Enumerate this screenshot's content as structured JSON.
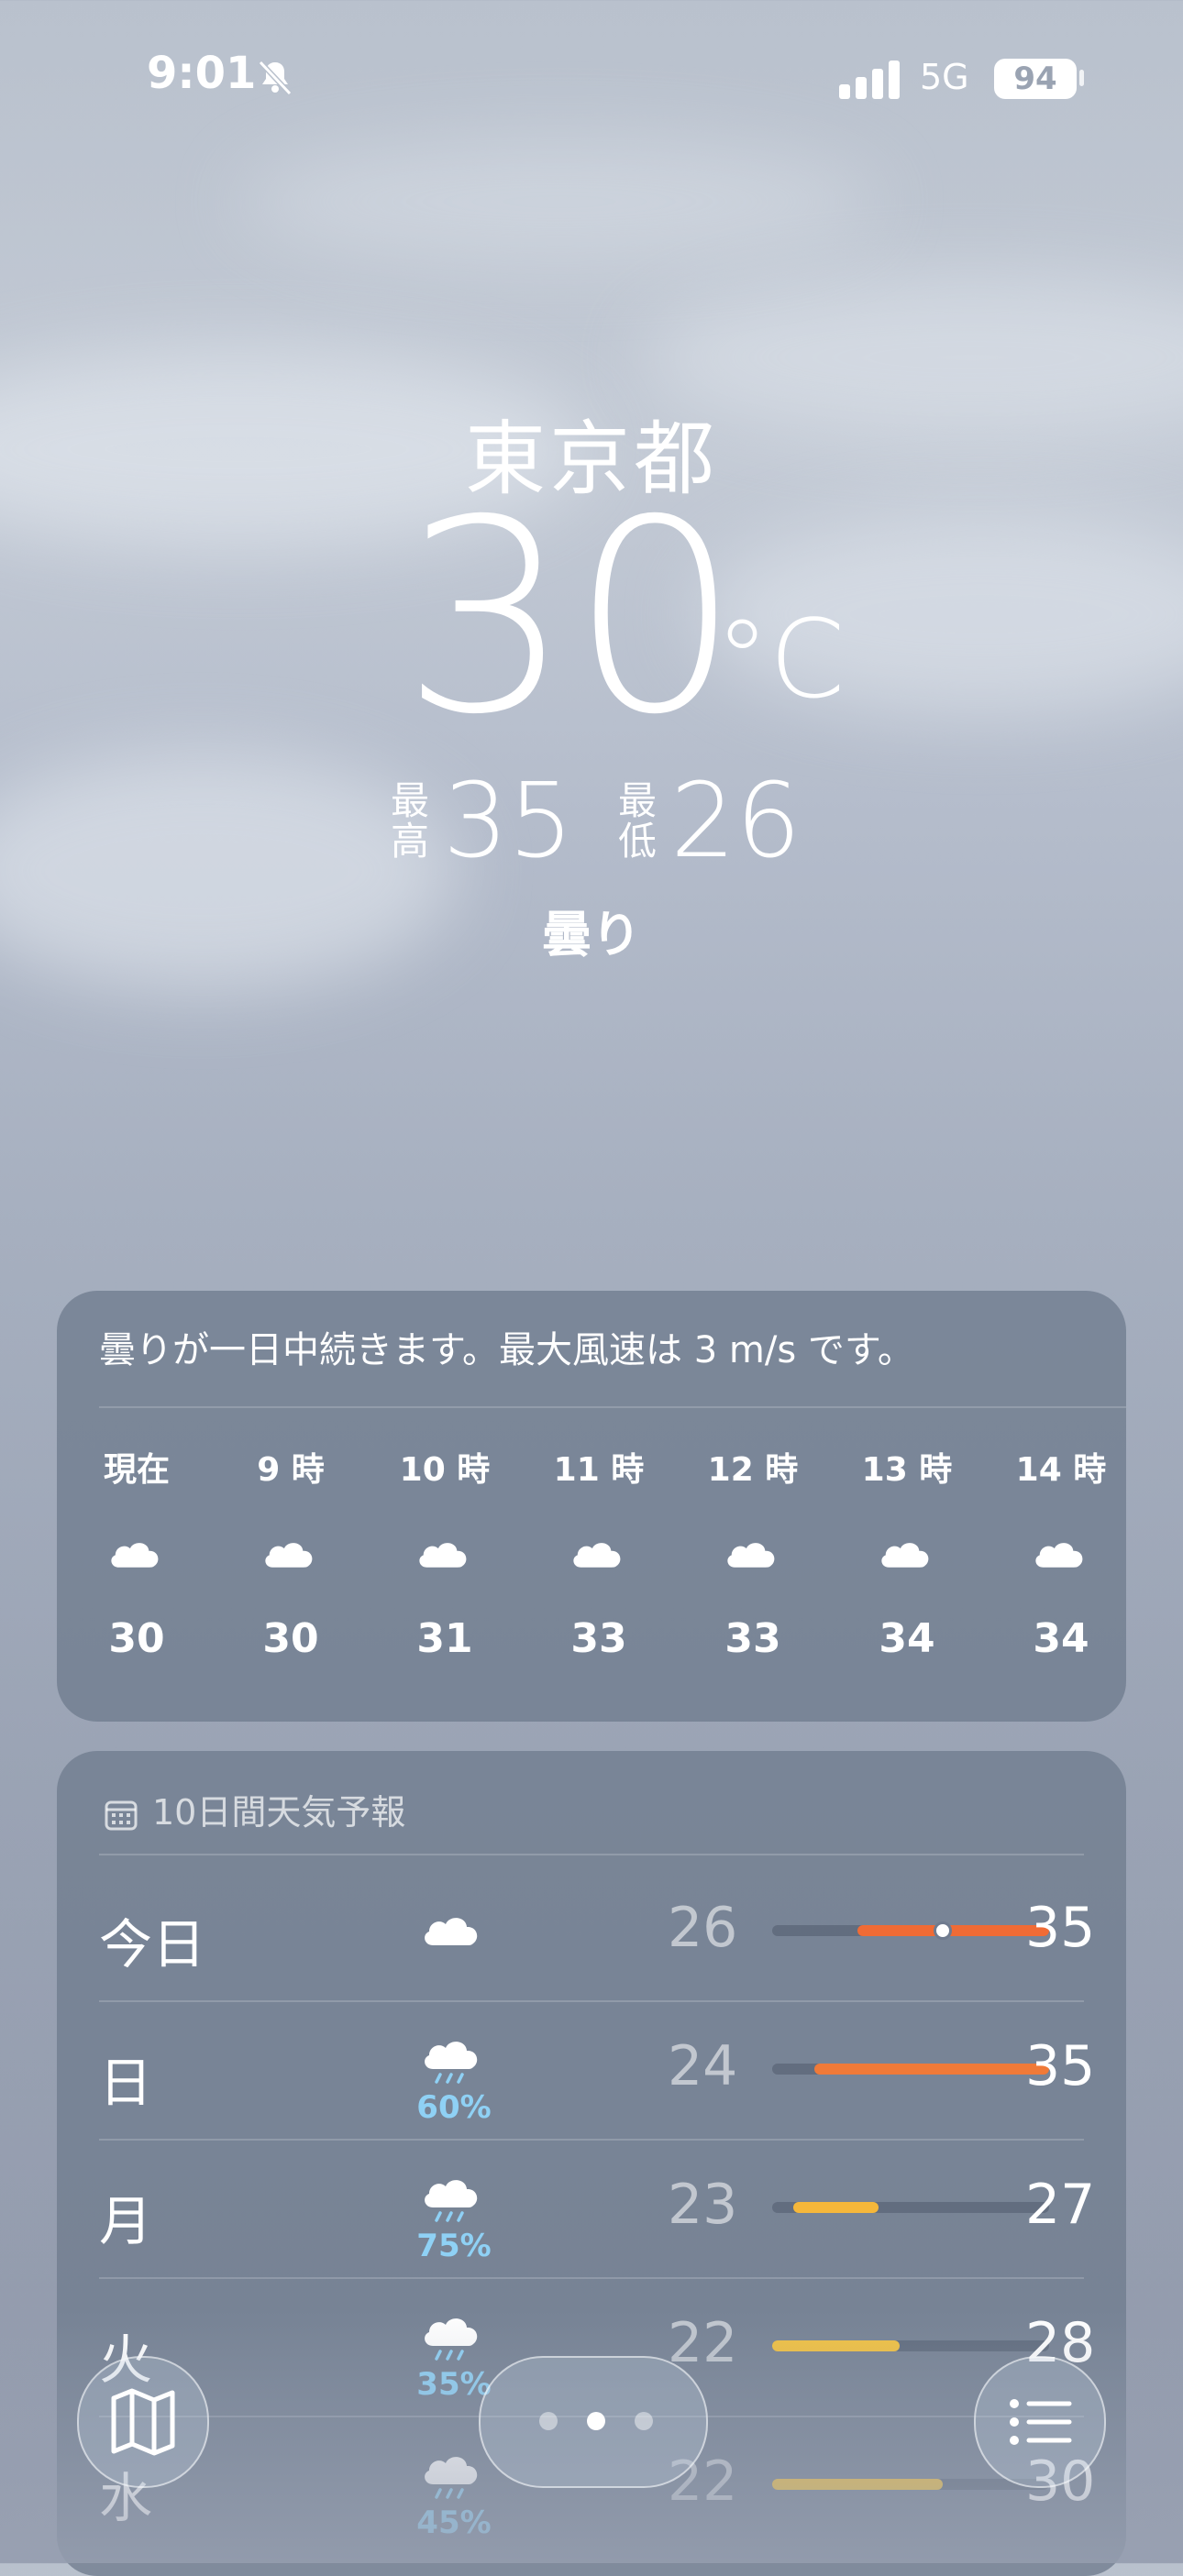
{
  "status_bar": {
    "time": "9:01",
    "network": "5G",
    "battery": "94",
    "icons": [
      "bell-slash-icon",
      "signal-icon",
      "battery-icon"
    ]
  },
  "location": "東京都",
  "current": {
    "temp": "30",
    "unit": "°C",
    "high_label": "最\n高",
    "high": "35",
    "low_label": "最\n低",
    "low": "26",
    "condition": "曇り"
  },
  "hourly_card": {
    "summary": "曇りが一日中続きます。最大風速は 3 m/s です。",
    "hours": [
      {
        "label": "現在",
        "temp": "30",
        "icon": "cloud-icon"
      },
      {
        "label": "9 時",
        "temp": "30",
        "icon": "cloud-icon"
      },
      {
        "label": "10 時",
        "temp": "31",
        "icon": "cloud-icon"
      },
      {
        "label": "11 時",
        "temp": "33",
        "icon": "cloud-icon"
      },
      {
        "label": "12 時",
        "temp": "33",
        "icon": "cloud-icon"
      },
      {
        "label": "13 時",
        "temp": "34",
        "icon": "cloud-icon"
      },
      {
        "label": "14 時",
        "temp": "34",
        "icon": "cloud-icon"
      }
    ]
  },
  "forecast_card": {
    "title": "10日間天気予報",
    "range_min": 22,
    "range_max": 35,
    "days": [
      {
        "day": "今日",
        "icon": "cloud-icon",
        "precip": "",
        "low": "26",
        "high": "35",
        "current_marker": 30,
        "bar_color": "#f06b35"
      },
      {
        "day": "日",
        "icon": "cloud-rain-icon",
        "precip": "60%",
        "low": "24",
        "high": "35",
        "bar_color": "#f07a38"
      },
      {
        "day": "月",
        "icon": "cloud-rain-icon",
        "precip": "75%",
        "low": "23",
        "high": "27",
        "bar_color": "#f5b73a"
      },
      {
        "day": "火",
        "icon": "cloud-rain-icon",
        "precip": "35%",
        "low": "22",
        "high": "28",
        "bar_color": "#f2c242"
      },
      {
        "day": "水",
        "icon": "cloud-rain-icon",
        "precip": "45%",
        "low": "22",
        "high": "30",
        "bar_color": "#f2c242"
      }
    ]
  },
  "bottom_bar": {
    "map_icon": "map-icon",
    "list_icon": "list-icon",
    "page_dots": 3,
    "active_dot": 1
  }
}
